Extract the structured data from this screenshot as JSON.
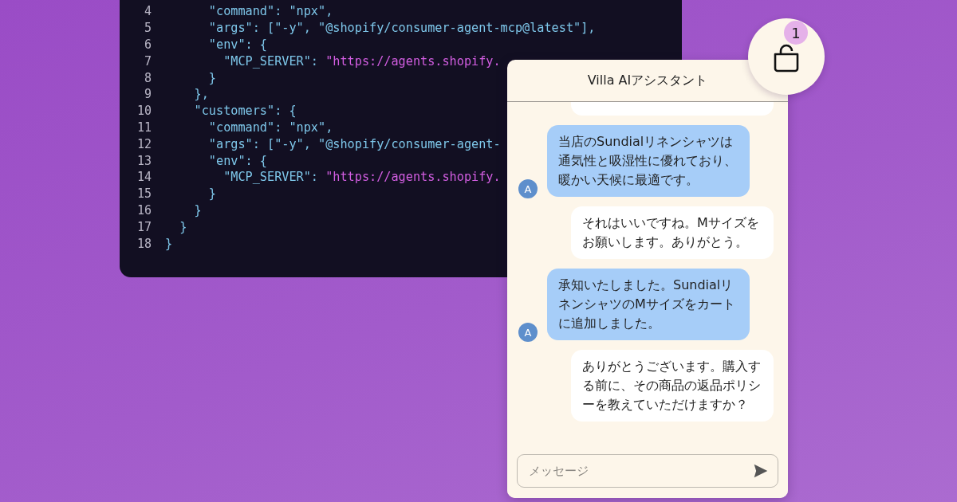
{
  "code_editor": {
    "lines": [
      {
        "number": "4",
        "segments": [
          {
            "kind": "code",
            "text": "      \"command\": \"npx\","
          }
        ]
      },
      {
        "number": "5",
        "segments": [
          {
            "kind": "code",
            "text": "      \"args\": [\"-y\", \"@shopify/consumer-agent-mcp@latest\"],"
          }
        ]
      },
      {
        "number": "6",
        "segments": [
          {
            "kind": "code",
            "text": "      \"env\": {"
          }
        ]
      },
      {
        "number": "7",
        "segments": [
          {
            "kind": "code",
            "text": "        \"MCP_SERVER\": "
          },
          {
            "kind": "url",
            "text": "\"https://agents.shopify."
          }
        ]
      },
      {
        "number": "8",
        "segments": [
          {
            "kind": "code",
            "text": "      }"
          }
        ]
      },
      {
        "number": "9",
        "segments": [
          {
            "kind": "code",
            "text": "    },"
          }
        ]
      },
      {
        "number": "10",
        "segments": [
          {
            "kind": "code",
            "text": "    \"customers\": {"
          }
        ]
      },
      {
        "number": "11",
        "segments": [
          {
            "kind": "code",
            "text": "      \"command\": \"npx\","
          }
        ]
      },
      {
        "number": "12",
        "segments": [
          {
            "kind": "code",
            "text": "      \"args\": [\"-y\", \"@shopify/consumer-agent-"
          }
        ]
      },
      {
        "number": "13",
        "segments": [
          {
            "kind": "code",
            "text": "      \"env\": {"
          }
        ]
      },
      {
        "number": "14",
        "segments": [
          {
            "kind": "code",
            "text": "        \"MCP_SERVER\": "
          },
          {
            "kind": "url",
            "text": "\"https://agents.shopify."
          }
        ]
      },
      {
        "number": "15",
        "segments": [
          {
            "kind": "code",
            "text": "      }"
          }
        ]
      },
      {
        "number": "16",
        "segments": [
          {
            "kind": "code",
            "text": "    }"
          }
        ]
      },
      {
        "number": "17",
        "segments": [
          {
            "kind": "code",
            "text": "  }"
          }
        ]
      },
      {
        "number": "18",
        "segments": [
          {
            "kind": "code",
            "text": "}"
          }
        ]
      }
    ]
  },
  "cart": {
    "badge": "1"
  },
  "chat": {
    "title": "Villa AIアシスタント",
    "messages": [
      {
        "kind": "partial"
      },
      {
        "kind": "assistant",
        "avatar": "A",
        "text": "当店のSundialリネンシャツは通気性と吸湿性に優れており、暖かい天候に最適です。"
      },
      {
        "kind": "user",
        "text": "それはいいですね。Mサイズをお願いします。ありがとう。"
      },
      {
        "kind": "assistant",
        "avatar": "A",
        "text": "承知いたしました。SundialリネンシャツのMサイズをカートに追加しました。"
      },
      {
        "kind": "user",
        "text": "ありがとうございます。購入する前に、その商品の返品ポリシーを教えていただけますか？"
      }
    ],
    "input": {
      "placeholder": "メッセージ"
    }
  }
}
